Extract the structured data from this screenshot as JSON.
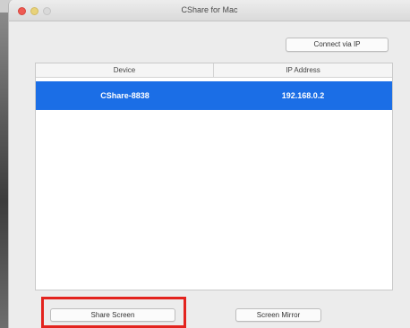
{
  "window": {
    "title": "CShare for Mac"
  },
  "toolbar": {
    "connect_label": "Connect via IP"
  },
  "table": {
    "columns": [
      "Device",
      "IP Address"
    ],
    "rows": [
      {
        "device": "CShare-8838",
        "ip": "192.168.0.2",
        "selected": true
      }
    ]
  },
  "footer": {
    "share_label": "Share Screen",
    "mirror_label": "Screen Mirror"
  },
  "colors": {
    "selection": "#1b6ee6",
    "highlight": "#e3231e"
  },
  "icons": {
    "close": "window-close-icon",
    "minimize": "window-minimize-icon",
    "zoom": "window-zoom-icon"
  }
}
